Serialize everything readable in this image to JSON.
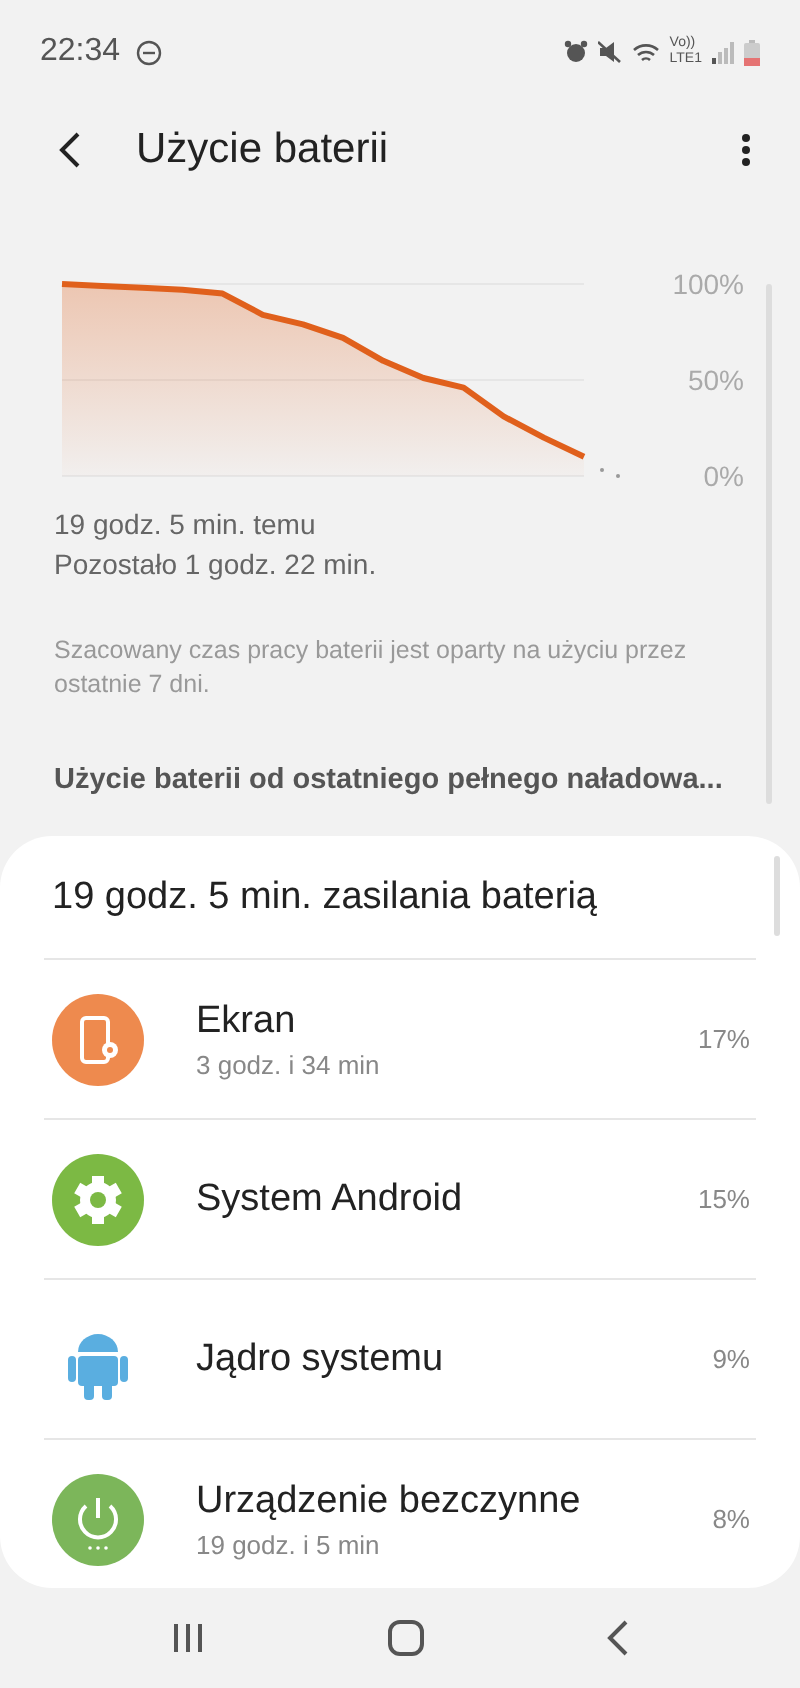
{
  "status_bar": {
    "time": "22:34",
    "volte": "Vo))",
    "network": "LTE1"
  },
  "header": {
    "title": "Użycie baterii"
  },
  "chart_data": {
    "type": "area",
    "ylim": [
      0,
      100
    ],
    "yticks": [
      {
        "value": 100,
        "label": "100%"
      },
      {
        "value": 50,
        "label": "50%"
      },
      {
        "value": 0,
        "label": "0%"
      }
    ],
    "series": [
      {
        "color": "#e0601c",
        "values": [
          100,
          99,
          98,
          97,
          95,
          84,
          79,
          72,
          60,
          51,
          46,
          31,
          20,
          10
        ]
      }
    ]
  },
  "chart_caption": [
    "19 godz. 5 min. temu",
    "Pozostało 1 godz. 22 min."
  ],
  "note": "Szacowany czas pracy baterii jest oparty na użyciu przez ostatnie 7 dni.",
  "section_title": "Użycie baterii od ostatniego pełnego naładowa...",
  "card": {
    "title": "19 godz. 5 min. zasilania baterią",
    "items": [
      {
        "kind": "screen",
        "color": "#ee8a4e",
        "name": "Ekran",
        "detail": "3 godz. i 34 min",
        "percent": "17%"
      },
      {
        "kind": "gear",
        "color": "#7cb944",
        "name": "System Android",
        "percent": "15%"
      },
      {
        "kind": "android",
        "color": "#5aaee0",
        "name": "Jądro systemu",
        "percent": "9%"
      },
      {
        "kind": "power",
        "color": "#7cb65a",
        "name": "Urządzenie bezczynne",
        "detail": "19 godz. i 5 min",
        "percent": "8%"
      }
    ]
  }
}
